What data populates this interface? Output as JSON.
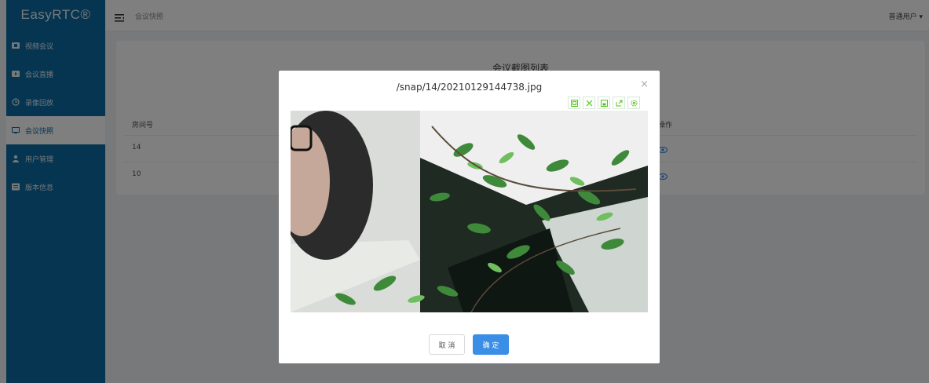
{
  "app": {
    "logo": "EasyRTC®"
  },
  "sidebar": {
    "items": [
      {
        "label": "视频会议",
        "icon": "video-icon"
      },
      {
        "label": "会议直播",
        "icon": "live-icon"
      },
      {
        "label": "录像回放",
        "icon": "playback-icon"
      },
      {
        "label": "会议快照",
        "icon": "snapshot-icon",
        "active": true
      },
      {
        "label": "用户管理",
        "icon": "user-icon"
      },
      {
        "label": "版本信息",
        "icon": "info-icon"
      }
    ]
  },
  "header": {
    "breadcrumb": "会议快照",
    "user": "普通用户 ▾"
  },
  "card": {
    "title": "会议截图列表",
    "columns": [
      "房间号",
      "操作"
    ],
    "rows": [
      {
        "room": "14"
      },
      {
        "room": "10"
      }
    ]
  },
  "dialog": {
    "title": "/snap/14/20210129144738.jpg",
    "close": "×",
    "toolbar": [
      "zoom-in-icon",
      "fullscreen-icon",
      "save-icon",
      "export-icon",
      "settings-icon"
    ],
    "cancel": "取 消",
    "ok": "确 定"
  },
  "colors": {
    "sidebar": "#0a6aa1",
    "primary": "#3a8ee6",
    "toolbar_icon": "#52c41a"
  }
}
